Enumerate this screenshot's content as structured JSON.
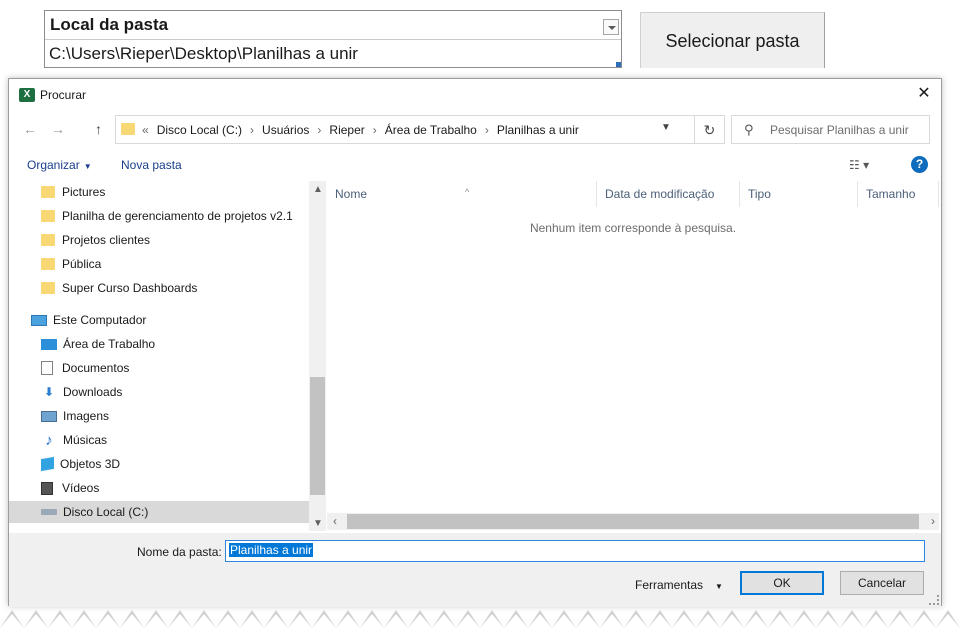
{
  "sheet": {
    "label": "Local da pasta",
    "value": "C:\\Users\\Rieper\\Desktop\\Planilhas a unir",
    "button": "Selecionar pasta"
  },
  "dialog": {
    "title": "Procurar",
    "close": "✕",
    "breadcrumbs": [
      "Disco Local (C:)",
      "Usuários",
      "Rieper",
      "Área de Trabalho",
      "Planilhas a unir"
    ],
    "overflow_marker": "«",
    "search_placeholder": "Pesquisar Planilhas a unir",
    "toolbar": {
      "organize": "Organizar",
      "new_folder": "Nova pasta"
    },
    "nav_items": [
      {
        "label": "Pictures"
      },
      {
        "label": "Planilha de gerenciamento de projetos v2.1"
      },
      {
        "label": "Projetos clientes"
      },
      {
        "label": "Pública"
      },
      {
        "label": "Super Curso Dashboards"
      },
      {
        "label": "Este Computador"
      },
      {
        "label": "Área de Trabalho"
      },
      {
        "label": "Documentos"
      },
      {
        "label": "Downloads"
      },
      {
        "label": "Imagens"
      },
      {
        "label": "Músicas"
      },
      {
        "label": "Objetos 3D"
      },
      {
        "label": "Vídeos"
      },
      {
        "label": "Disco Local (C:)"
      }
    ],
    "columns": [
      "Nome",
      "Data de modificação",
      "Tipo",
      "Tamanho"
    ],
    "empty_message": "Nenhum item corresponde à pesquisa.",
    "folder_name_label": "Nome da pasta:",
    "folder_name_value": "Planilhas a unir",
    "tools_label": "Ferramentas",
    "ok_label": "OK",
    "cancel_label": "Cancelar",
    "accent_color": "#0078d7"
  }
}
